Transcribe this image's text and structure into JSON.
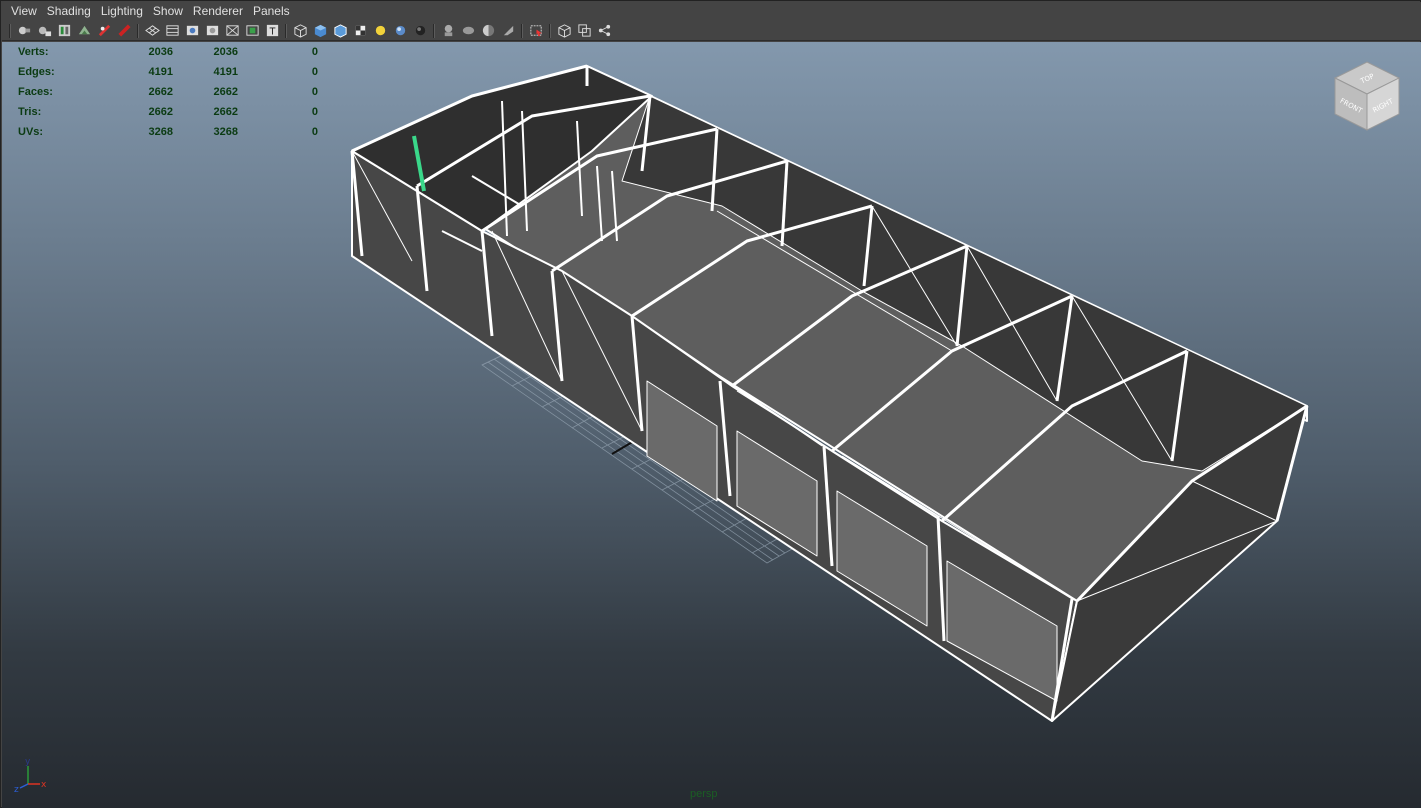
{
  "menu": [
    "View",
    "Shading",
    "Lighting",
    "Show",
    "Renderer",
    "Panels"
  ],
  "toolbar": {
    "group1": [
      "camera-select-icon",
      "camera-attributes-icon",
      "bookmarks-icon",
      "image-plane-icon",
      "grease-pencil-icon",
      "2d-pan-zoom-icon"
    ],
    "group2": [
      "grid-icon",
      "film-gate-icon",
      "resolution-gate-icon",
      "gate-mask-icon",
      "field-chart-icon",
      "safe-title-icon"
    ],
    "group3": [
      "wireframe-icon",
      "smooth-shade-icon",
      "wireframe-on-shaded-icon",
      "textured-icon",
      "use-all-lights-icon",
      "shadows-icon",
      "screen-space-ao-icon"
    ],
    "group4": [
      "xray-icon",
      "xray-active-icon",
      "xray-joints-icon",
      "backface-icon"
    ],
    "group5": [
      "isolate-select-icon"
    ],
    "group6": [
      "hardware-renderer-icon",
      "two-sided-lighting-icon",
      "node-editor-icon"
    ]
  },
  "hud": {
    "rows": [
      {
        "label": "Verts:",
        "a": "2036",
        "b": "2036",
        "c": "0"
      },
      {
        "label": "Edges:",
        "a": "4191",
        "b": "4191",
        "c": "0"
      },
      {
        "label": "Faces:",
        "a": "2662",
        "b": "2662",
        "c": "0"
      },
      {
        "label": "Tris:",
        "a": "2662",
        "b": "2662",
        "c": "0"
      },
      {
        "label": "UVs:",
        "a": "3268",
        "b": "3268",
        "c": "0"
      }
    ]
  },
  "viewcube": {
    "top": "TOP",
    "front": "FRONT",
    "right": "RIGHT"
  },
  "camera_label": "persp",
  "axis": {
    "x": "x",
    "y": "y",
    "z": "z"
  },
  "colors": {
    "viewport_top": "#8398ad",
    "viewport_bottom": "#252a30",
    "hud_text": "#0b3b12",
    "wire": "#ffffff",
    "face_dark": "#3c3c3c",
    "face_floor": "#5e5e5e",
    "selected_edge": "#3ad88a"
  }
}
